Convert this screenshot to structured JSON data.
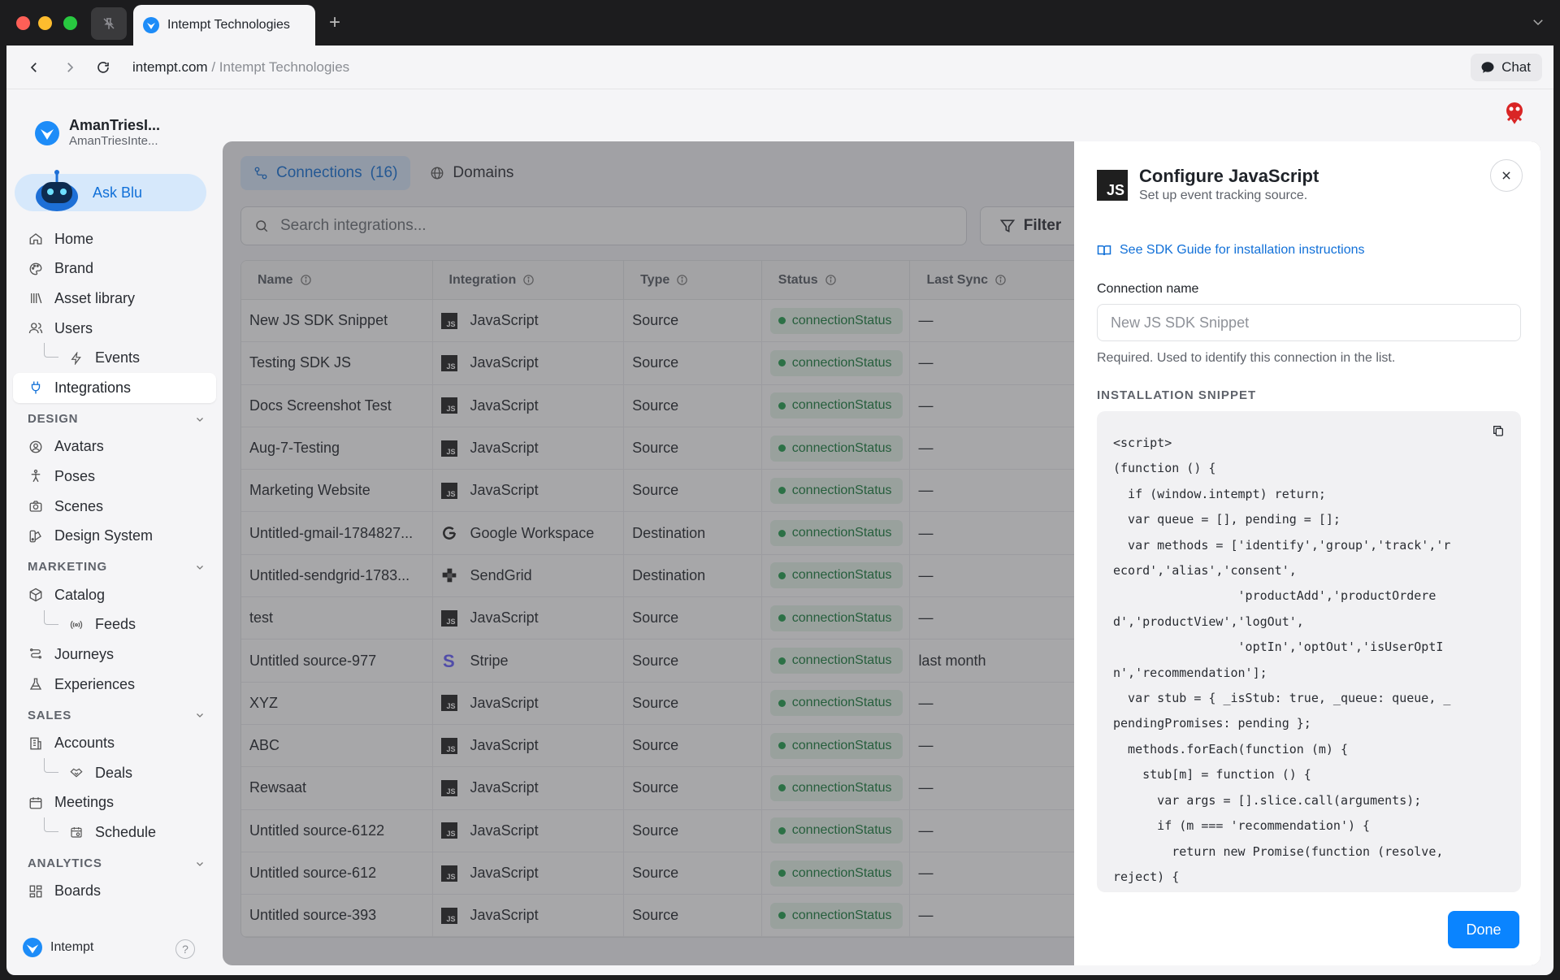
{
  "browser": {
    "tab_title": "Intempt Technologies",
    "url_domain": "intempt.com",
    "url_separator": "/",
    "url_page": "Intempt Technologies",
    "chat_label": "Chat"
  },
  "workspace": {
    "name": "AmanTriesI...",
    "sub": "AmanTriesInte..."
  },
  "ask_blu": "Ask Blu",
  "nav": {
    "home": "Home",
    "brand": "Brand",
    "asset_library": "Asset library",
    "users": "Users",
    "events": "Events",
    "integrations": "Integrations",
    "design_section": "DESIGN",
    "avatars": "Avatars",
    "poses": "Poses",
    "scenes": "Scenes",
    "design_system": "Design System",
    "marketing_section": "MARKETING",
    "catalog": "Catalog",
    "feeds": "Feeds",
    "journeys": "Journeys",
    "experiences": "Experiences",
    "sales_section": "SALES",
    "accounts": "Accounts",
    "deals": "Deals",
    "meetings": "Meetings",
    "schedule": "Schedule",
    "analytics_section": "ANALYTICS",
    "boards": "Boards"
  },
  "footer": {
    "brand": "Intempt",
    "help": "?"
  },
  "main": {
    "tab_connections": "Connections",
    "connections_count": "(16)",
    "tab_domains": "Domains",
    "search_placeholder": "Search integrations...",
    "filter_label": "Filter",
    "columns": [
      "Name",
      "Integration",
      "Type",
      "Status",
      "Last Sync"
    ],
    "rows": [
      {
        "name": "New JS SDK Snippet",
        "integration": "JavaScript",
        "icon": "js",
        "type": "Source",
        "status": "connectionStatus",
        "last_sync": "—"
      },
      {
        "name": "Testing SDK JS",
        "integration": "JavaScript",
        "icon": "js",
        "type": "Source",
        "status": "connectionStatus",
        "last_sync": "—"
      },
      {
        "name": "Docs Screenshot Test",
        "integration": "JavaScript",
        "icon": "js",
        "type": "Source",
        "status": "connectionStatus",
        "last_sync": "—"
      },
      {
        "name": "Aug-7-Testing",
        "integration": "JavaScript",
        "icon": "js",
        "type": "Source",
        "status": "connectionStatus",
        "last_sync": "—"
      },
      {
        "name": "Marketing Website",
        "integration": "JavaScript",
        "icon": "js",
        "type": "Source",
        "status": "connectionStatus",
        "last_sync": "—"
      },
      {
        "name": "Untitled-gmail-1784827...",
        "integration": "Google Workspace",
        "icon": "google",
        "type": "Destination",
        "status": "connectionStatus",
        "last_sync": "—"
      },
      {
        "name": "Untitled-sendgrid-1783...",
        "integration": "SendGrid",
        "icon": "sendgrid",
        "type": "Destination",
        "status": "connectionStatus",
        "last_sync": "—"
      },
      {
        "name": "test",
        "integration": "JavaScript",
        "icon": "js",
        "type": "Source",
        "status": "connectionStatus",
        "last_sync": "—"
      },
      {
        "name": "Untitled source-977",
        "integration": "Stripe",
        "icon": "stripe",
        "type": "Source",
        "status": "connectionStatus",
        "last_sync": "last month"
      },
      {
        "name": "XYZ",
        "integration": "JavaScript",
        "icon": "js",
        "type": "Source",
        "status": "connectionStatus",
        "last_sync": "—"
      },
      {
        "name": "ABC",
        "integration": "JavaScript",
        "icon": "js",
        "type": "Source",
        "status": "connectionStatus",
        "last_sync": "—"
      },
      {
        "name": "Rewsaat",
        "integration": "JavaScript",
        "icon": "js",
        "type": "Source",
        "status": "connectionStatus",
        "last_sync": "—"
      },
      {
        "name": "Untitled source-6122",
        "integration": "JavaScript",
        "icon": "js",
        "type": "Source",
        "status": "connectionStatus",
        "last_sync": "—"
      },
      {
        "name": "Untitled source-612",
        "integration": "JavaScript",
        "icon": "js",
        "type": "Source",
        "status": "connectionStatus",
        "last_sync": "—"
      },
      {
        "name": "Untitled source-393",
        "integration": "JavaScript",
        "icon": "js",
        "type": "Source",
        "status": "connectionStatus",
        "last_sync": "—"
      }
    ]
  },
  "drawer": {
    "logo_text": "JS",
    "title": "Configure JavaScript",
    "subtitle": "Set up event tracking source.",
    "sdk_link": "See SDK Guide for installation instructions",
    "field_label": "Connection name",
    "field_placeholder": "New JS SDK Snippet",
    "field_help": "Required. Used to identify this connection in the list.",
    "snippet_label": "INSTALLATION SNIPPET",
    "code_lines": [
      "<script>",
      "(function () {",
      "  if (window.intempt) return;",
      "  var queue = [], pending = [];",
      "  var methods = ['identify','group','track','r",
      "ecord','alias','consent',",
      "                 'productAdd','productOrdere",
      "d','productView','logOut',",
      "                 'optIn','optOut','isUserOptI",
      "n','recommendation'];",
      "  var stub = { _isStub: true, _queue: queue, _",
      "pendingPromises: pending };",
      "  methods.forEach(function (m) {",
      "    stub[m] = function () {",
      "      var args = [].slice.call(arguments);",
      "      if (m === 'recommendation') {",
      "        return new Promise(function (resolve,",
      "reject) {"
    ],
    "done_label": "Done"
  },
  "colors": {
    "accent": "#0a84ff",
    "status_green": "#1f9d4c",
    "brand_blue": "#1d8cf8"
  }
}
